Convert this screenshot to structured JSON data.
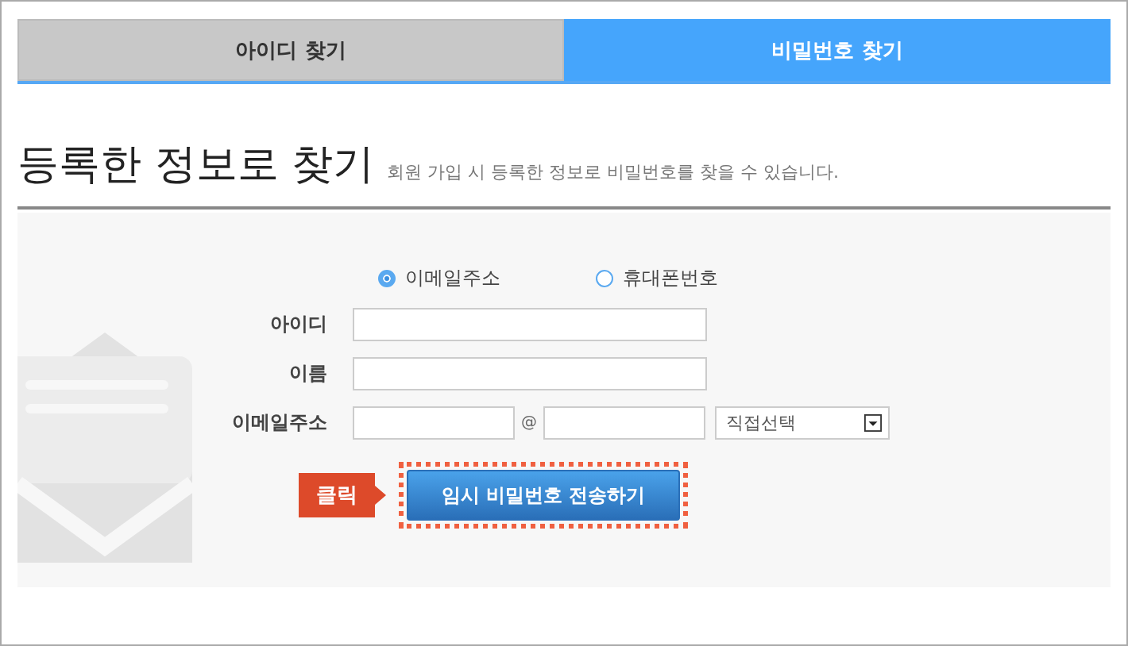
{
  "tabs": [
    {
      "label": "아이디 찾기",
      "selected": false
    },
    {
      "label": "비밀번호 찾기",
      "selected": true
    }
  ],
  "heading": {
    "title": "등록한 정보로 찾기",
    "subtitle": "회원 가입 시 등록한 정보로 비밀번호를 찾을 수 있습니다."
  },
  "search_by": [
    {
      "label": "이메일주소",
      "selected": true
    },
    {
      "label": "휴대폰번호",
      "selected": false
    }
  ],
  "fields": [
    {
      "kind": "text",
      "label": "아이디"
    },
    {
      "kind": "text",
      "label": "이름"
    },
    {
      "kind": "email",
      "label": "이메일주소",
      "separator": "@",
      "domain_select": "직접선택"
    }
  ],
  "callout": "클릭",
  "submit_button": "임시 비밀번호 전송하기"
}
